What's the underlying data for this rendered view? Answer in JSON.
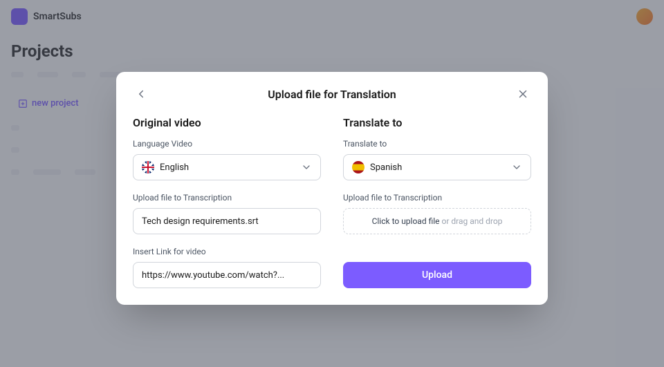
{
  "brand": "SmartSubs",
  "page_title": "Projects",
  "new_project_label": "new project",
  "modal": {
    "title": "Upload file for Translation",
    "left": {
      "heading": "Original video",
      "language_label": "Language Video",
      "language_value": "English",
      "upload_label": "Upload file to Transcription",
      "uploaded_file": "Tech design requirements.srt",
      "link_label": "Insert Link for video",
      "link_value": "https://www.youtube.com/watch?..."
    },
    "right": {
      "heading": "Translate to",
      "translate_label": "Translate to",
      "translate_value": "Spanish",
      "upload_label": "Upload file to Transcription",
      "dropzone_action": "Click to upload file",
      "dropzone_hint": " or drag and drop",
      "upload_button": "Upload"
    }
  }
}
